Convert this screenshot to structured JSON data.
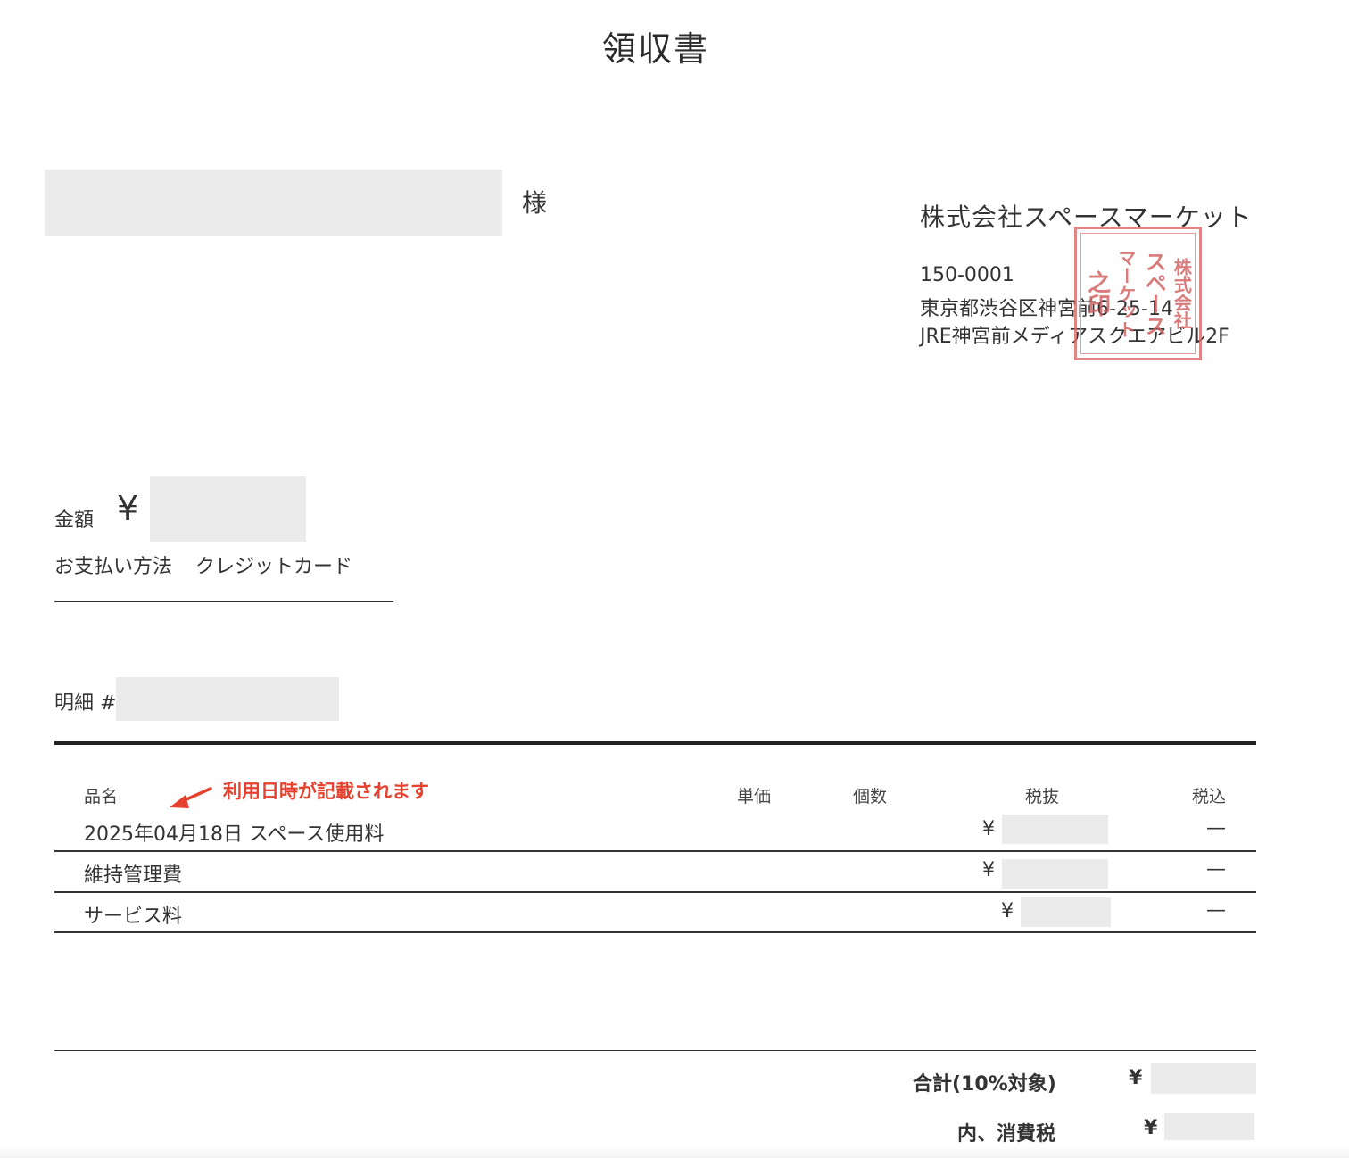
{
  "title": "領収書",
  "recipient": {
    "suffix": "様"
  },
  "issuer": {
    "company": "株式会社スペースマーケット",
    "postal": "150-0001",
    "address1": "東京都渋谷区神宮前6-25-14",
    "address2": "JRE神宮前メディアスクエアビル2F",
    "seal_columns": [
      "株式会社",
      "スペース",
      "マーケット",
      "之印"
    ]
  },
  "amount": {
    "label": "金額",
    "currency": "¥"
  },
  "payment": {
    "label": "お支払い方法",
    "method": "クレジットカード"
  },
  "statement": {
    "label": "明細 #"
  },
  "table": {
    "headers": {
      "item": "品名",
      "unit_price": "単価",
      "qty": "個数",
      "excl_tax": "税抜",
      "incl_tax": "税込"
    },
    "annotation": "利用日時が記載されます",
    "rows": [
      {
        "name": "2025年04月18日 スペース使用料",
        "currency": "¥",
        "incl": "—"
      },
      {
        "name": "維持管理費",
        "currency": "¥",
        "incl": "—"
      },
      {
        "name": "サービス料",
        "currency": "¥",
        "incl": "—"
      }
    ]
  },
  "totals": {
    "total_label": "合計(10%対象)",
    "total_currency": "¥",
    "tax_label": "内、消費税",
    "tax_currency": "¥"
  },
  "colors": {
    "accent": "#e5412e",
    "seal": "#d35f5f",
    "redaction": "#ebebeb"
  }
}
